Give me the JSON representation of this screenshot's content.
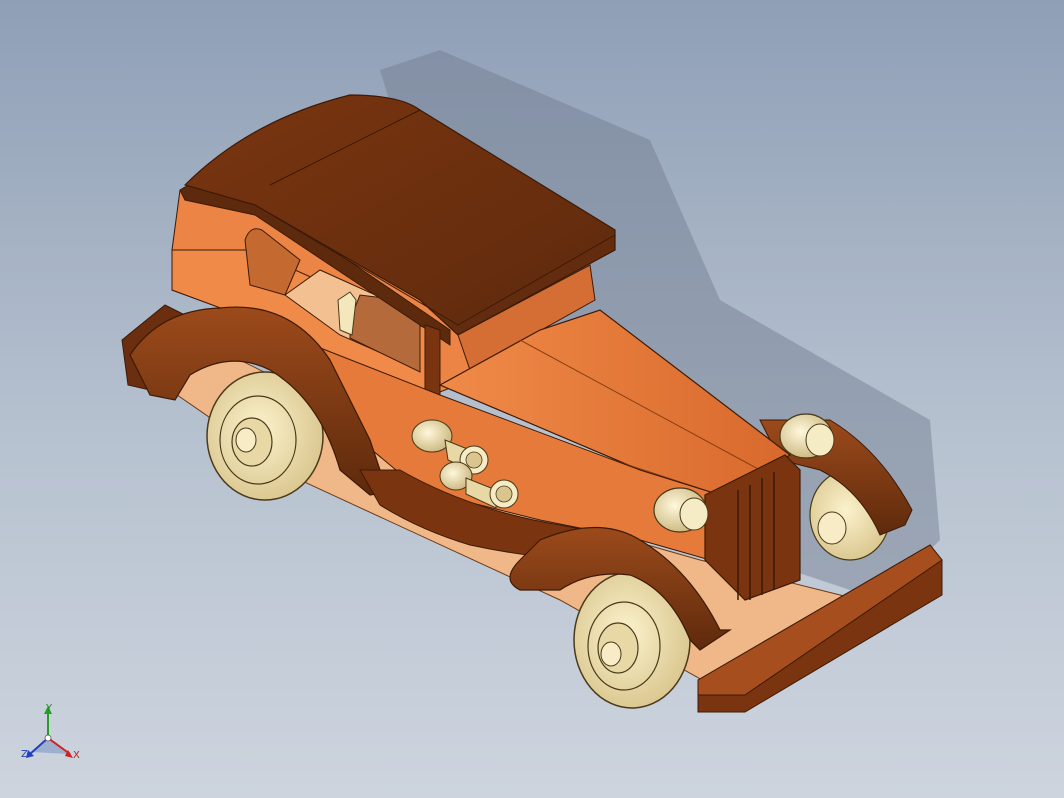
{
  "viewport": {
    "model": "wooden-toy-vintage-car",
    "background_top": "#8f9fb6",
    "background_bottom": "#cdd4de"
  },
  "colors": {
    "dark_wood": "#7a3510",
    "mid_wood": "#a64e1e",
    "light_wood": "#ec8445",
    "pale_wood": "#f0b888",
    "cream": "#f3e7bb"
  },
  "triad": {
    "x_label": "X",
    "y_label": "Y",
    "z_label": "Z",
    "x_color": "#d02020",
    "y_color": "#22a022",
    "z_color": "#2040c0"
  }
}
